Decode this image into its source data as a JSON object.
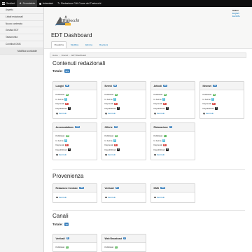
{
  "toolbar": {
    "items": [
      {
        "label": "Gestisci",
        "icon": "menu-icon"
      },
      {
        "label": "Scorciatoie",
        "icon": "star-icon"
      },
      {
        "label": "fcdamiani",
        "icon": "user-icon"
      },
      {
        "label": "Redazione CAI Cuore dei Trabocchi",
        "icon": "pencil-icon"
      }
    ]
  },
  "tray": {
    "items": [
      "Aspetto",
      "Listati redazionali",
      "Nuovo contenuto",
      "Gestisci EDT",
      "Tassonomia",
      "Contributi DMS"
    ],
    "sub_item": "Modifica scorciatoie"
  },
  "user": {
    "name": "Sellen",
    "links": [
      "English",
      "Esci/Me"
    ]
  },
  "page": {
    "title": "EDT Dashboard",
    "tabs": [
      "Visualizza",
      "Modifica",
      "Elimina",
      "Revisioni"
    ],
    "breadcrumb": [
      "Home",
      "Itinerari",
      "EDT Dashboard"
    ]
  },
  "sections": {
    "contents": {
      "title": "Contenuti redazionali",
      "total_label": "Totale:",
      "total_value": "474",
      "cards": [
        {
          "title": "Luoghi",
          "badge": "99",
          "stats": [
            "99",
            "0",
            "0",
            "0"
          ]
        },
        {
          "title": "Eventi",
          "badge": "19",
          "stats": [
            "17",
            "0",
            "0",
            "2"
          ]
        },
        {
          "title": "Articoli",
          "badge": "25",
          "stats": [
            "25",
            "0",
            "0",
            "0"
          ]
        },
        {
          "title": "Itinerari",
          "badge": "74",
          "stats": [
            "74",
            "0",
            "0",
            "0"
          ]
        },
        {
          "title": "Accomodations",
          "badge": "246",
          "stats": [
            "246",
            "0",
            "0",
            "0"
          ]
        },
        {
          "title": "Offerte",
          "badge": "10",
          "stats": [
            "10",
            "0",
            "0",
            "0"
          ]
        },
        {
          "title": "Ristorazione",
          "badge": "1",
          "stats": [
            "1",
            "0",
            "0",
            "0"
          ]
        }
      ],
      "stat_labels": [
        "Pubblicati",
        "In bozza",
        "Deprecati",
        "Depubblicati"
      ],
      "see_all": "Vedi tutti"
    },
    "origin": {
      "title": "Provenienza",
      "cards": [
        {
          "title": "Redazione Centrale",
          "badge": "150"
        },
        {
          "title": "Verticali",
          "badge": "14"
        },
        {
          "title": "DMS",
          "badge": "236"
        }
      ],
      "see_all": "Vedi tutti"
    },
    "channels": {
      "title": "Canali",
      "total_label": "Totale:",
      "total_value": "10",
      "cards": [
        {
          "title": "Verticali",
          "badge": "4",
          "first_stat": "4"
        },
        {
          "title": "Web Broadcast",
          "badge": "4",
          "first_stat": "4"
        }
      ],
      "first_stat_label": "Pubblicati"
    }
  },
  "colors": {
    "toolbar": "#0f0f0f",
    "link": "#0071b8",
    "badge": "#3c81bd",
    "published": "#5cb85c",
    "draft": "#5bc0de",
    "deprecated": "#d9534f",
    "unpublished": "#222222"
  }
}
